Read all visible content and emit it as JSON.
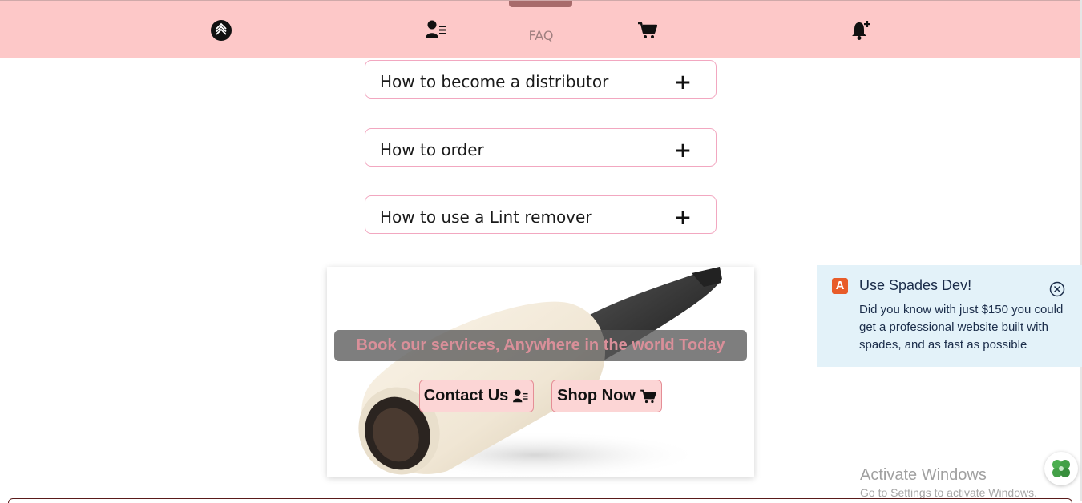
{
  "nav": {
    "items": [
      {
        "icon": "brand-logo-icon"
      },
      {
        "icon": "user-list-icon"
      },
      {
        "label": "FAQ"
      },
      {
        "icon": "cart-icon"
      },
      {
        "icon": "bell-plus-icon"
      }
    ],
    "faq_label": "FAQ",
    "bg_color": "#fdc8c8"
  },
  "faq": {
    "items": [
      {
        "question": "How to become a distributor",
        "toggle": "+"
      },
      {
        "question": "How to order",
        "toggle": "+"
      },
      {
        "question": "How to use a Lint remover",
        "toggle": "+"
      }
    ]
  },
  "banner": {
    "tagline": "Book our services, Anywhere in the world Today",
    "contact_label": "Contact Us",
    "shop_label": "Shop Now",
    "image": "lint-roller-image"
  },
  "toast": {
    "title": "Use Spades Dev!",
    "body": "Did you know with just $150 you could get a professional website built with spades, and as fast as possible",
    "logo_letter": "A",
    "accent_color": "#e85c2a"
  },
  "watermark": {
    "title": "Activate Windows",
    "subtitle": "Go to Settings to activate Windows."
  }
}
